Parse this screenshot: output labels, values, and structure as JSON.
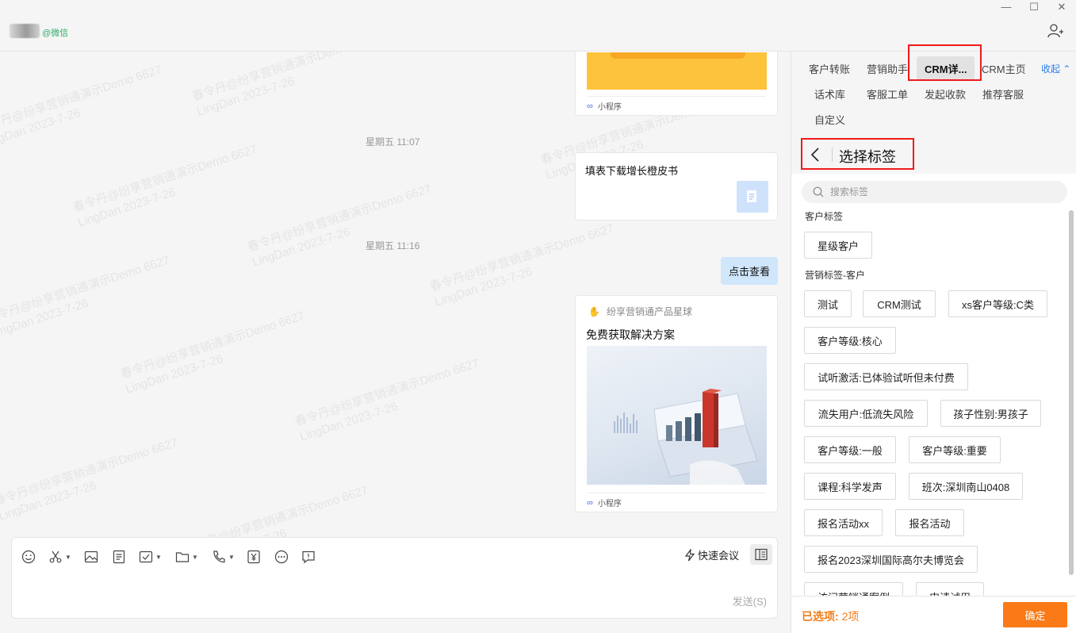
{
  "window": {
    "wechat_tag": "@微信",
    "controls": [
      "—",
      "☐",
      "✕"
    ]
  },
  "chat": {
    "messages": [
      {
        "type": "mini_program",
        "footer": "小程序"
      },
      {
        "type": "time",
        "text": "星期五 11:07"
      },
      {
        "type": "file",
        "title": "填表下载增长橙皮书"
      },
      {
        "type": "time",
        "text": "星期五 11:16"
      },
      {
        "type": "text",
        "text": "点击查看"
      },
      {
        "type": "mini_program",
        "source": "纷享营销通产品星球",
        "title": "免费获取解决方案",
        "footer": "小程序"
      }
    ],
    "watermark_lines": [
      "春令丹@纷享营销通演示Demo 6627",
      "LingDan 2023-7-26"
    ]
  },
  "composer": {
    "tools": [
      "emoji-icon",
      "scissors-icon",
      "image-icon",
      "document-icon",
      "checklist-icon",
      "folder-icon",
      "phone-icon",
      "yuan-icon",
      "more-icon",
      "feedback-icon"
    ],
    "quick_meeting": "快速会议",
    "send": "发送(S)"
  },
  "panel": {
    "tabs": [
      "客户转账",
      "营销助手",
      "CRM详...",
      "CRM主页",
      "话术库",
      "客服工单",
      "发起收款",
      "推荐客服",
      "自定义"
    ],
    "active_tab": "CRM详...",
    "collapse": "收起",
    "select_title": "选择标签",
    "search_placeholder": "搜索标签",
    "sections": [
      {
        "title": "客户标签",
        "tags": [
          "星级客户"
        ]
      },
      {
        "title": "营销标签-客户",
        "tags": [
          "测试",
          "CRM测试",
          "xs客户等级:C类",
          "客户等级:核心",
          "试听激活:已体验试听但未付费",
          "流失用户:低流失风险",
          "孩子性别:男孩子",
          "客户等级:一般",
          "客户等级:重要",
          "课程:科学发声",
          "班次:深圳南山0408",
          "报名活动xx",
          "报名活动",
          "报名2023深圳国际高尔夫博览会",
          "访问营销通案例",
          "申请试用"
        ]
      }
    ],
    "footer": {
      "selected_label": "已选项:",
      "selected_count": "2项",
      "confirm": "确定"
    }
  },
  "colors": {
    "accent_orange": "#fa7a17",
    "highlight_red": "#f01a1a",
    "link_blue": "#2b7de9",
    "bubble_blue": "#cfe6fb",
    "wechat_green": "#2aae67"
  }
}
